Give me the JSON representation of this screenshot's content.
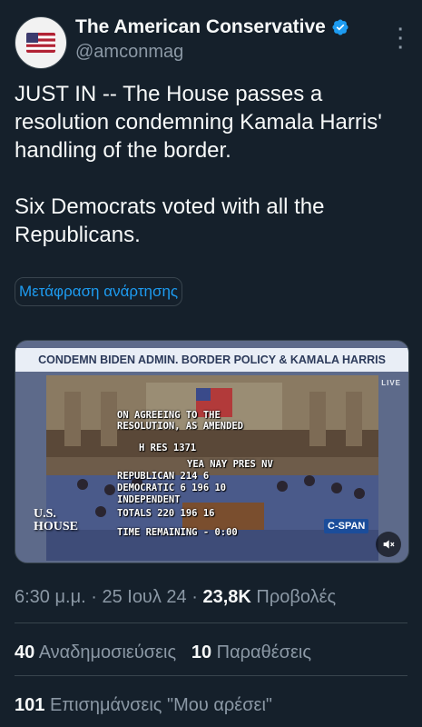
{
  "author": {
    "display_name": "The American Conservative",
    "handle": "@amconmag",
    "avatar_icon": "us-flag-avatar-icon",
    "verified_color": "#1d9bf0"
  },
  "tweet": {
    "paragraphs": [
      "JUST IN -- The House passes a resolution condemning Kamala Harris' handling of the border.",
      "Six Democrats voted with all the Republicans."
    ],
    "translate_label": "Μετάφραση ανάρτησης"
  },
  "media": {
    "banner": "CONDEMN BIDEN ADMIN. BORDER POLICY & KAMALA HARRIS",
    "live": "LIVE",
    "vote_title_1": "ON AGREEING TO THE",
    "vote_title_2": "RESOLUTION, AS AMENDED",
    "bill": "H RES       1371",
    "header_row": "YEA NAY PRES NV",
    "rows": [
      "REPUBLICAN   214            6",
      "DEMOCRATIC     6  196       10",
      "INDEPENDENT",
      "TOTALS       220  196       16"
    ],
    "time_remaining": "TIME REMAINING - 0:00",
    "us_house": "U.S.",
    "us_house_2": "HOUSE",
    "network": "C-SPAN",
    "mute_icon": "mute-icon"
  },
  "meta": {
    "time": "6:30 μ.μ.",
    "separator": "·",
    "date": "25 Ιουλ 24",
    "views_count": "23,8K",
    "views_label": "Προβολές"
  },
  "stats": {
    "reposts_count": "40",
    "reposts_label": "Αναδημοσιεύσεις",
    "quotes_count": "10",
    "quotes_label": "Παραθέσεις",
    "likes_count": "101",
    "likes_label": "Επισημάνσεις \"Μου αρέσει\""
  },
  "colors": {
    "background": "#15202b",
    "text": "#f7f9f9",
    "secondary": "#8b98a5",
    "accent": "#1d9bf0",
    "border": "#38444d"
  }
}
